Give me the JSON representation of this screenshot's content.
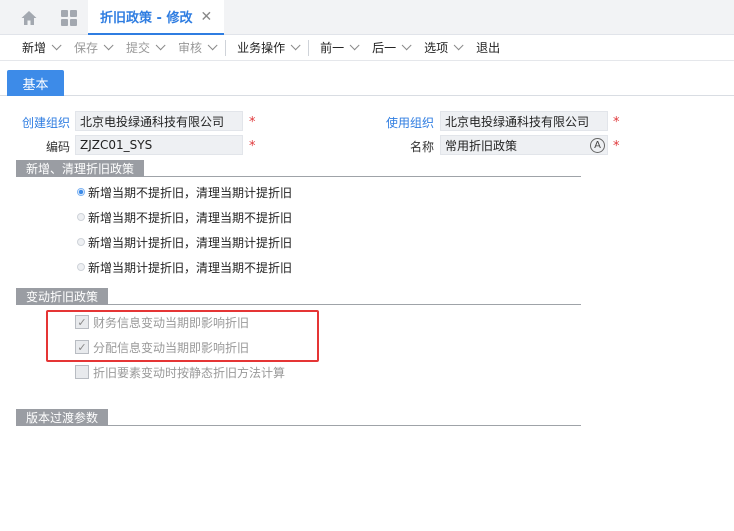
{
  "topbar": {
    "tab_title": "折旧政策 - 修改",
    "close_glyph": "✕",
    "home_icon": "home-icon",
    "apps_icon": "apps-grid-icon"
  },
  "toolbar": {
    "items": [
      {
        "label": "新增",
        "disabled": false
      },
      {
        "label": "保存",
        "disabled": true
      },
      {
        "label": "提交",
        "disabled": true
      },
      {
        "label": "审核",
        "disabled": true
      },
      {
        "label": "业务操作",
        "disabled": false
      },
      {
        "label": "前一",
        "disabled": false
      },
      {
        "label": "后一",
        "disabled": false
      },
      {
        "label": "选项",
        "disabled": false
      },
      {
        "label": "退出",
        "disabled": false
      }
    ]
  },
  "subtab": {
    "label": "基本"
  },
  "form": {
    "create_org_label": "创建组织",
    "create_org_value": "北京电投绿通科技有限公司",
    "use_org_label": "使用组织",
    "use_org_value": "北京电投绿通科技有限公司",
    "code_label": "编码",
    "code_value": "ZJZC01_SYS",
    "name_label": "名称",
    "name_value": "常用折旧政策",
    "required_mark": "*",
    "name_icon_glyph": "A"
  },
  "section_new": {
    "title": "新增、清理折旧政策",
    "options": [
      {
        "label": "新增当期不提折旧，清理当期计提折旧",
        "selected": true
      },
      {
        "label": "新增当期不提折旧，清理当期不提折旧",
        "selected": false
      },
      {
        "label": "新增当期计提折旧，清理当期计提折旧",
        "selected": false
      },
      {
        "label": "新增当期计提折旧，清理当期不提折旧",
        "selected": false
      }
    ]
  },
  "section_change": {
    "title": "变动折旧政策",
    "options": [
      {
        "label": "财务信息变动当期即影响折旧",
        "checked": true
      },
      {
        "label": "分配信息变动当期即影响折旧",
        "checked": true
      },
      {
        "label": "折旧要素变动时按静态折旧方法计算",
        "checked": false
      }
    ]
  },
  "section_version": {
    "title": "版本过渡参数"
  },
  "colors": {
    "accent": "#2f7de1",
    "tab_active": "#3d8be8",
    "required": "#e0373a",
    "highlight": "#e53535"
  }
}
